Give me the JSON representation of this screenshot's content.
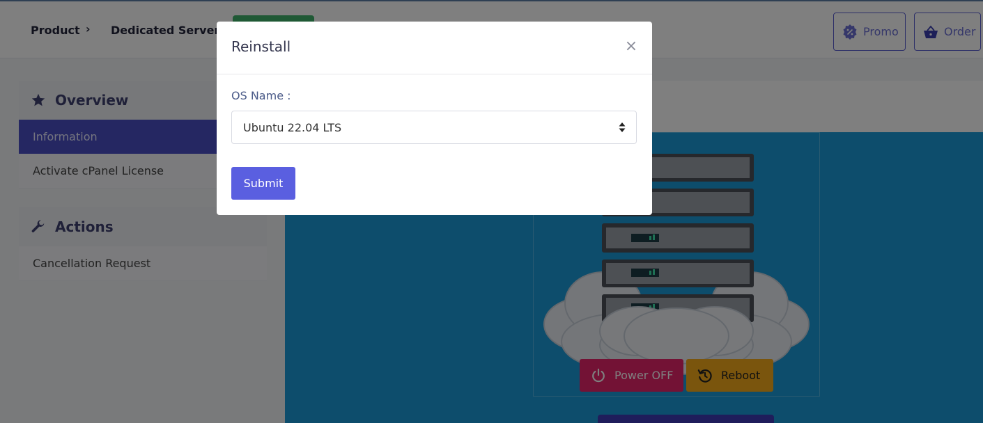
{
  "breadcrumb": {
    "items": [
      "Product",
      "Dedicated Server"
    ],
    "separator": "›"
  },
  "header": {
    "promo_label": "Promo",
    "order_label": "Order"
  },
  "sidebar": {
    "overview": {
      "title": "Overview",
      "items": [
        {
          "label": "Information",
          "active": true
        },
        {
          "label": "Activate cPanel License",
          "active": false
        }
      ]
    },
    "actions": {
      "title": "Actions",
      "items": [
        {
          "label": "Cancellation Request"
        }
      ]
    }
  },
  "server_controls": {
    "power_label": "Power OFF",
    "reboot_label": "Reboot"
  },
  "modal": {
    "title": "Reinstall",
    "close_glyph": "×",
    "os_label": "OS Name :",
    "os_selected": "Ubuntu 22.04 LTS",
    "submit_label": "Submit"
  },
  "colors": {
    "accent": "#5a5fe0",
    "sidebar_active": "#4b4fc4",
    "hero_bg": "#1a9bd8",
    "power": "#e6246b",
    "reboot": "#f4aa1a",
    "status_badge": "#3fb36b"
  },
  "icons": {
    "promo": "promo-badge-icon",
    "order": "basket-icon",
    "overview": "star-icon",
    "actions": "wrench-icon",
    "power": "power-icon",
    "reboot": "history-icon"
  }
}
